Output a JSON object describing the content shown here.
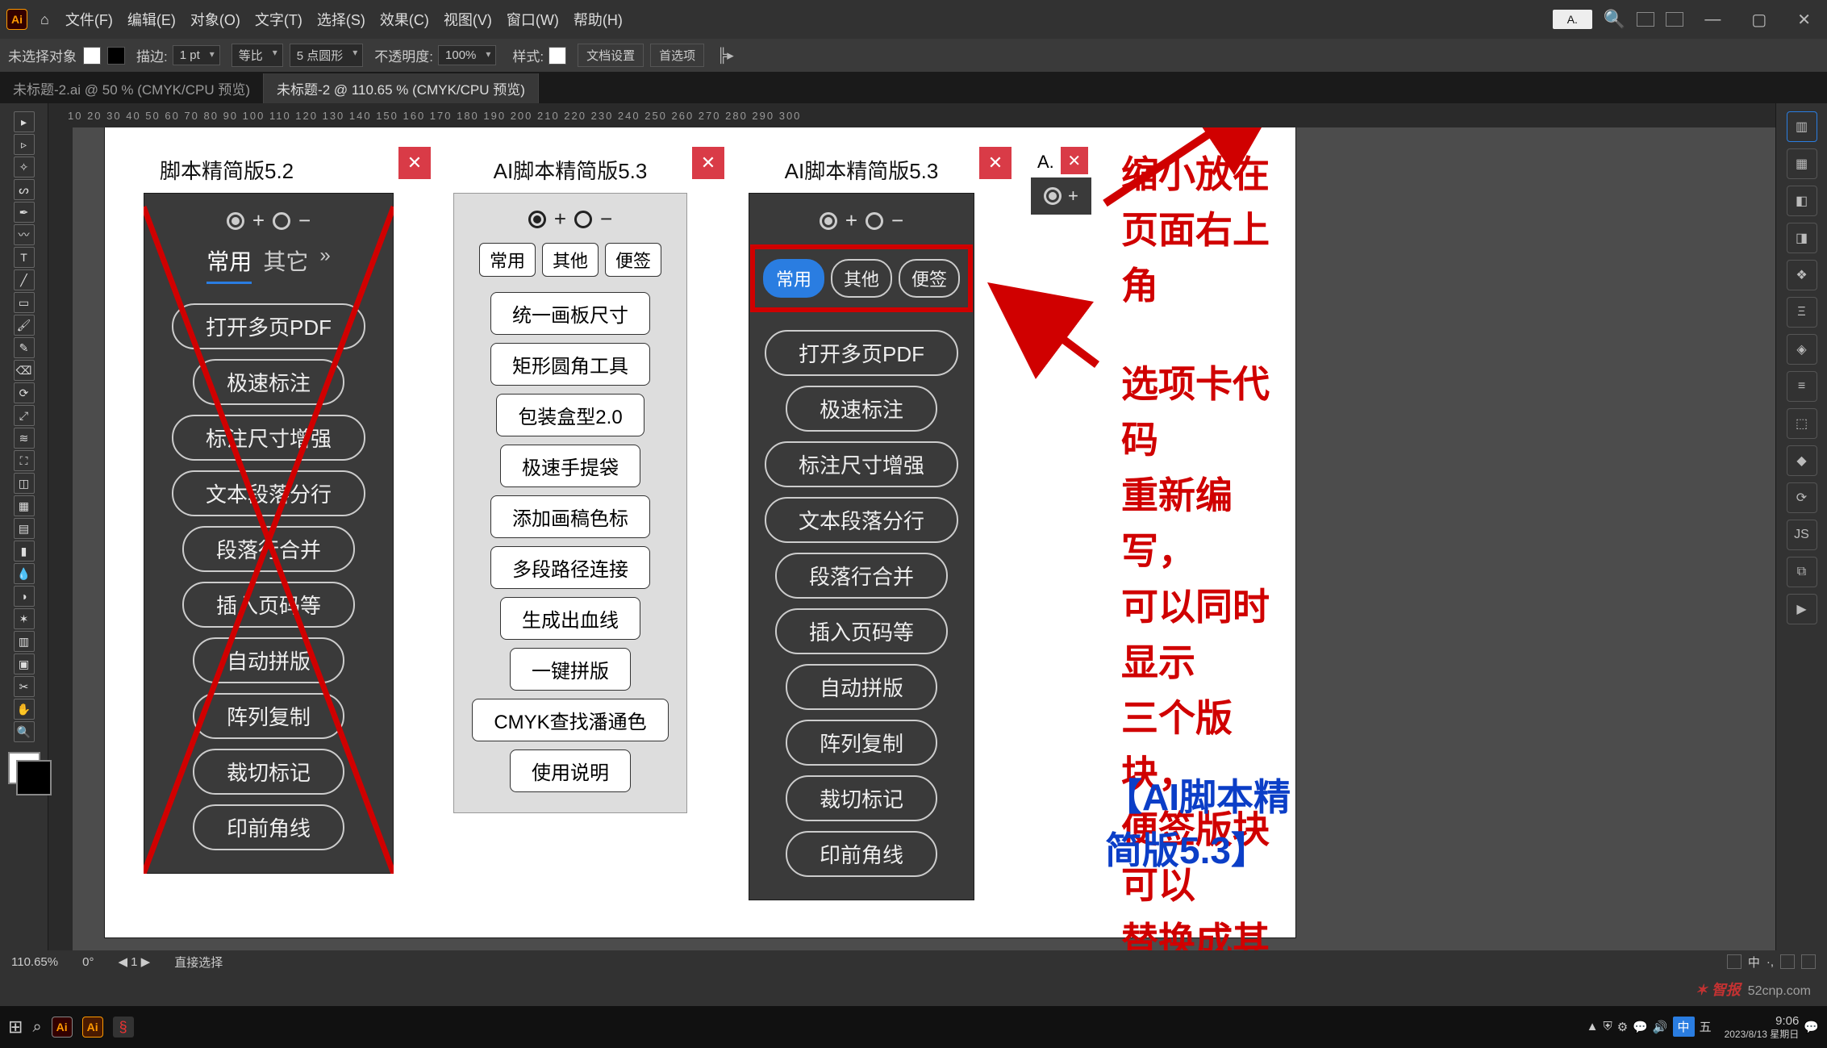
{
  "menubar": {
    "items": [
      "文件(F)",
      "编辑(E)",
      "对象(O)",
      "文字(T)",
      "选择(S)",
      "效果(C)",
      "视图(V)",
      "窗口(W)",
      "帮助(H)"
    ],
    "doc_hint": "A."
  },
  "controlbar": {
    "no_selection": "未选择对象",
    "stroke_label": "描边:",
    "stroke_val": "1 pt",
    "uniform": "等比",
    "corner_val": "5 点圆形",
    "opacity_label": "不透明度:",
    "opacity_val": "100%",
    "style_label": "样式:",
    "doc_setup": "文档设置",
    "prefs": "首选项"
  },
  "tabs": {
    "tab1": "未标题-2.ai @ 50 % (CMYK/CPU 预览)",
    "tab2": "未标题-2 @ 110.65 % (CMYK/CPU 预览)"
  },
  "ruler_ticks": "10   20   30   40   50   60   70   80   90   100  110  120  130  140  150  160  170  180  190  200  210  220  230  240  250  260  270  280  290  300",
  "panelA": {
    "title": "脚本精简版5.2",
    "tabs": [
      "常用",
      "其它"
    ],
    "buttons": [
      "打开多页PDF",
      "极速标注",
      "标注尺寸增强",
      "文本段落分行",
      "段落行合并",
      "插入页码等",
      "自动拼版",
      "阵列复制",
      "裁切标记",
      "印前角线"
    ]
  },
  "panelB": {
    "title": "AI脚本精简版5.3",
    "tabs": [
      "常用",
      "其他",
      "便签"
    ],
    "buttons": [
      "统一画板尺寸",
      "矩形圆角工具",
      "包装盒型2.0",
      "极速手提袋",
      "添加画稿色标",
      "多段路径连接",
      "生成出血线",
      "一键拼版",
      "CMYK查找潘通色",
      "使用说明"
    ]
  },
  "panelC": {
    "title": "AI脚本精简版5.3",
    "tabs": [
      "常用",
      "其他",
      "便签"
    ],
    "buttons": [
      "打开多页PDF",
      "极速标注",
      "标注尺寸增强",
      "文本段落分行",
      "段落行合并",
      "插入页码等",
      "自动拼版",
      "阵列复制",
      "裁切标记",
      "印前角线"
    ]
  },
  "panelD": {
    "title": "A."
  },
  "annotation": {
    "line1": "缩小放在",
    "line2": "页面右上角",
    "line3": "选项卡代码",
    "line4": "重新编写，",
    "line5": "可以同时显示",
    "line6": "三个版块，",
    "line7": "便签版块可以",
    "line8": "替换成其他脚本。",
    "blue": "【AI脚本精简版5.3】"
  },
  "status": {
    "zoom": "110.65%",
    "tool": "直接选择"
  },
  "taskbar": {
    "ime": "中",
    "time": "9:06",
    "date": "2023/8/13 星期日"
  },
  "watermark": "52cnp.com"
}
